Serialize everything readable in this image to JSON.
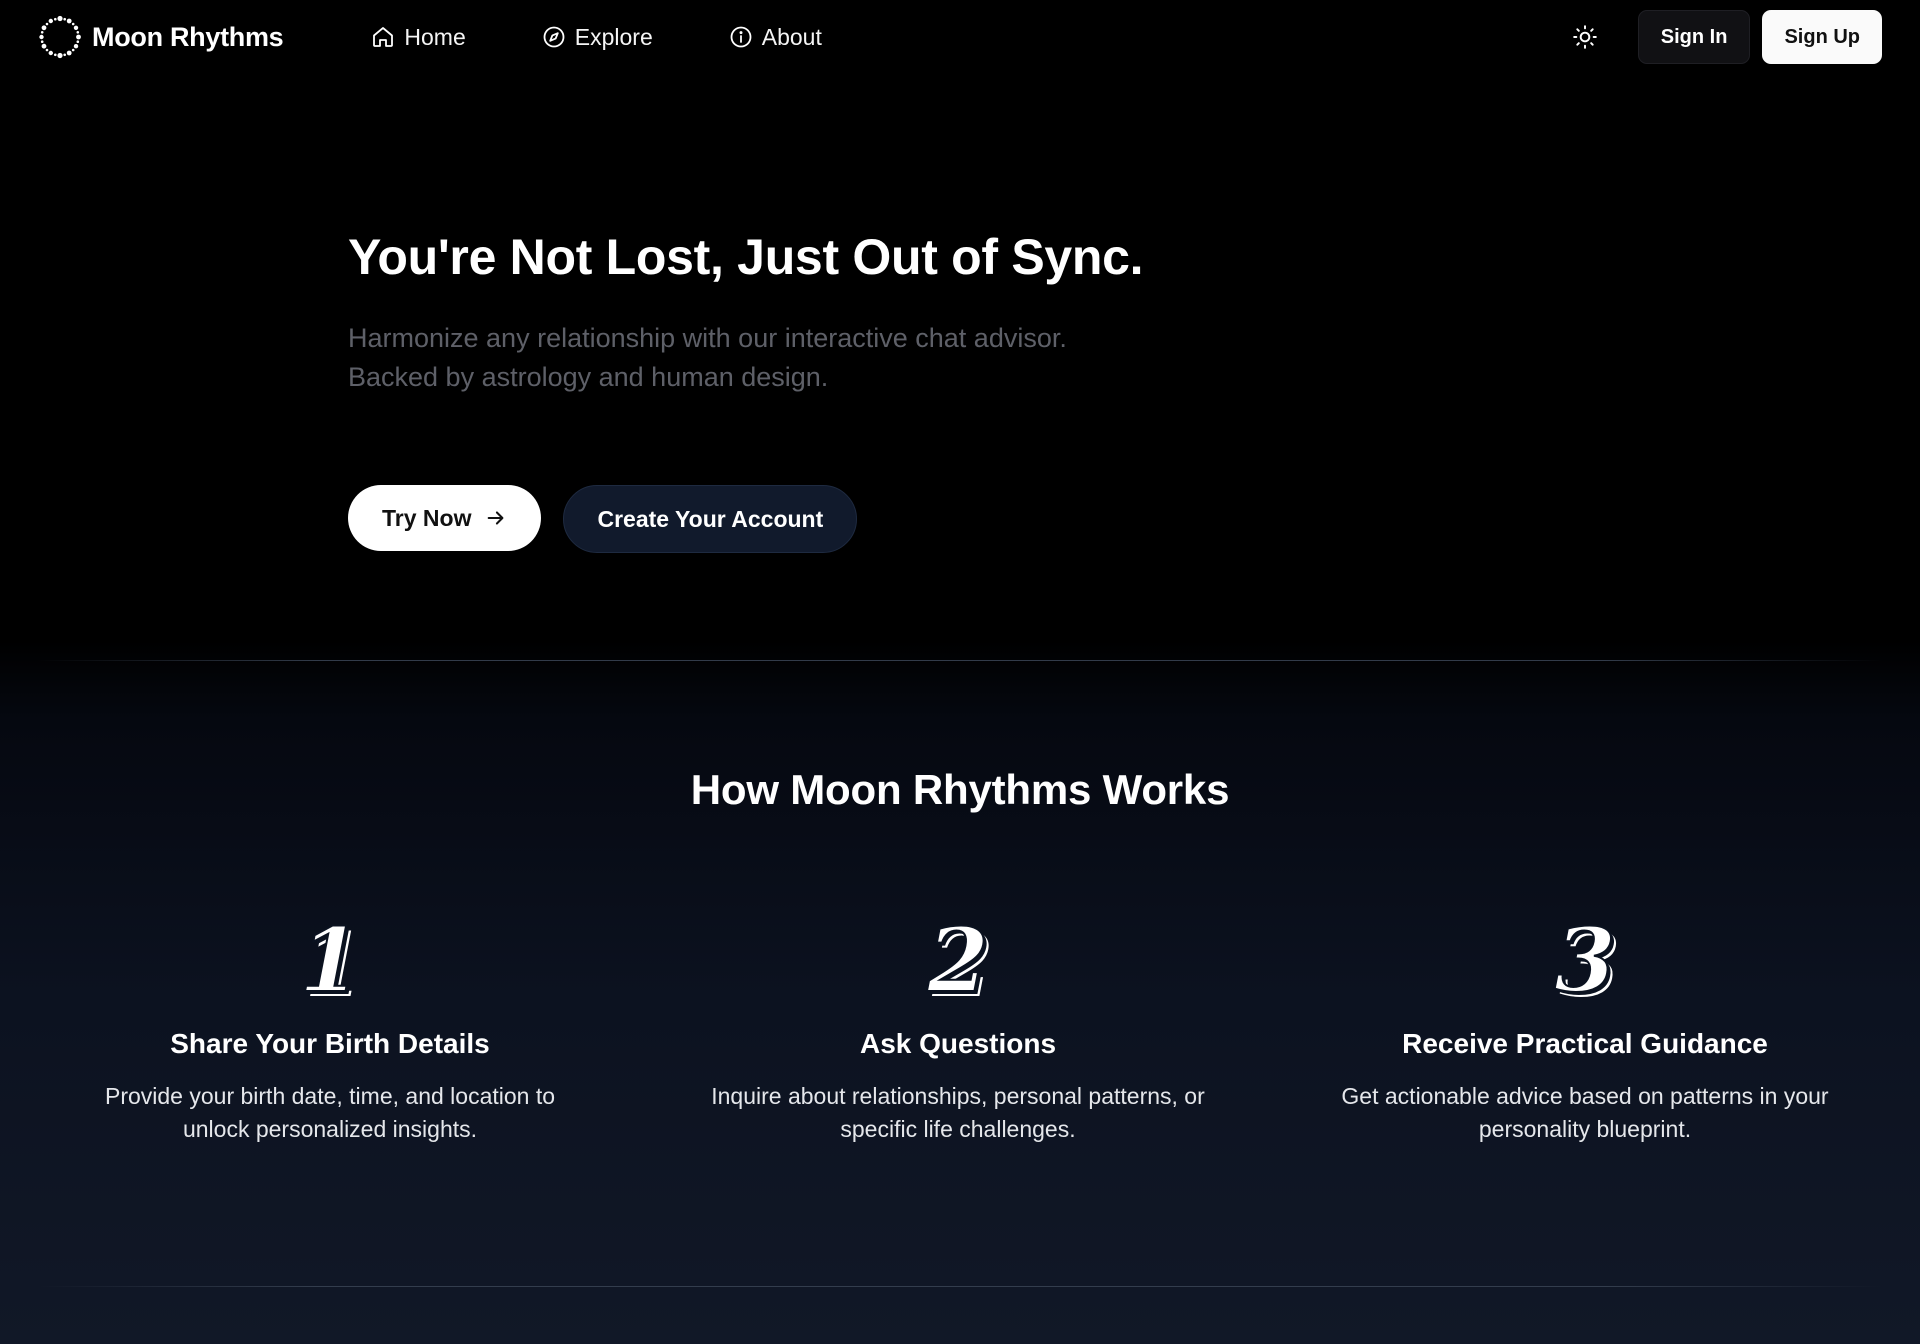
{
  "nav": {
    "brand": "Moon Rhythms",
    "links": [
      {
        "label": "Home",
        "icon": "home-icon"
      },
      {
        "label": "Explore",
        "icon": "compass-icon"
      },
      {
        "label": "About",
        "icon": "info-icon"
      }
    ],
    "theme_icon": "sun-icon",
    "sign_in": "Sign In",
    "sign_up": "Sign Up"
  },
  "hero": {
    "title": "You're Not Lost, Just Out of Sync.",
    "subtitle_line1": "Harmonize any relationship with our interactive chat advisor.",
    "subtitle_line2": "Backed by astrology and human design.",
    "try_now": "Try Now",
    "create_account": "Create Your Account"
  },
  "how": {
    "title": "How Moon Rhythms Works",
    "steps": [
      {
        "number": "1",
        "title": "Share Your Birth Details",
        "desc_line1": "Provide your birth date, time, and location to",
        "desc_line2": "unlock personalized insights."
      },
      {
        "number": "2",
        "title": "Ask Questions",
        "desc_line1": "Inquire about relationships, personal patterns, or",
        "desc_line2": "specific life challenges."
      },
      {
        "number": "3",
        "title": "Receive Practical Guidance",
        "desc_line1": "Get actionable advice based on patterns in your",
        "desc_line2": "personality blueprint."
      }
    ]
  },
  "colors": {
    "background_top": "#000000",
    "background_bottom": "#111827",
    "subtitle": "#5e6068",
    "secondary_button": "#111a2c"
  }
}
